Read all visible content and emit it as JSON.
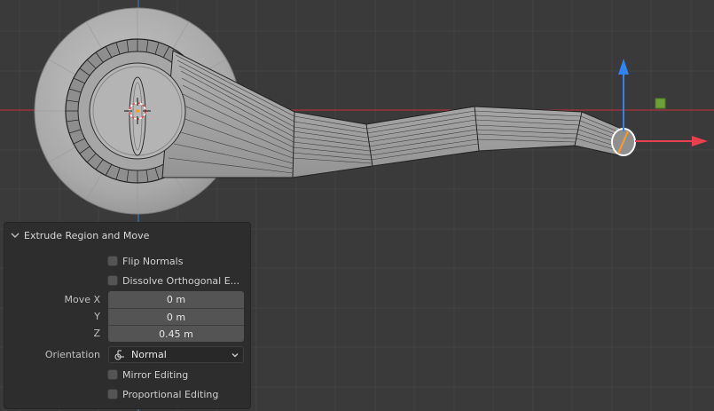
{
  "panel": {
    "title": "Extrude Region and Move",
    "flip_normals": "Flip Normals",
    "dissolve_orthogonal": "Dissolve Orthogonal E...",
    "move_x_label": "Move X",
    "move_x_value": "0 m",
    "y_label": "Y",
    "y_value": "0 m",
    "z_label": "Z",
    "z_value": "0.45 m",
    "orientation_label": "Orientation",
    "orientation_value": "Normal",
    "mirror_editing": "Mirror Editing",
    "proportional_editing": "Proportional Editing"
  },
  "colors": {
    "viewport_bg": "#3a3a3a",
    "grid": "#434343",
    "axis_x": "#b5323f",
    "axis_y": "#3f6ea6",
    "gizmo_z": "#2f84f2",
    "gizmo_x": "#e8404f",
    "gizmo_plane": "#6fa038",
    "selection": "#ff9b22"
  },
  "icons": [
    "chevron-down-icon",
    "normal-orientation-icon",
    "dropdown-arrow-icon"
  ]
}
